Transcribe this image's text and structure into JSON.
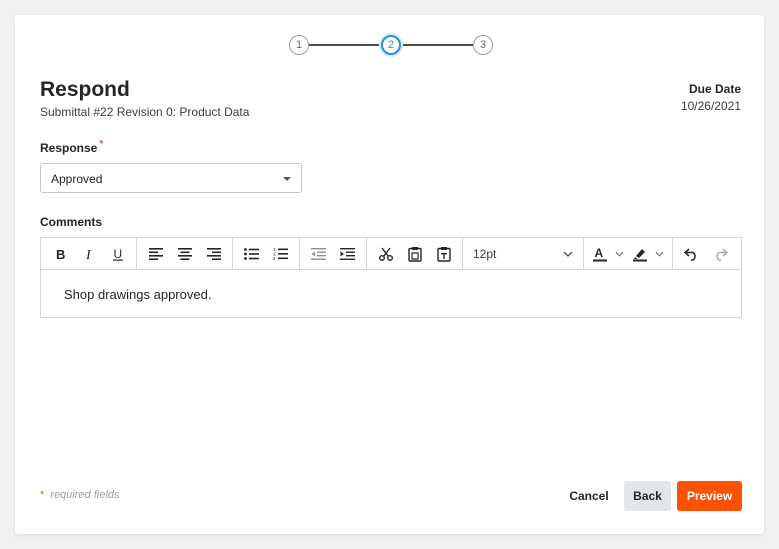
{
  "stepper": {
    "steps": [
      "1",
      "2",
      "3"
    ],
    "active": 2
  },
  "header": {
    "title": "Respond",
    "subtitle": "Submittal #22 Revision 0: Product Data",
    "due_label": "Due Date",
    "due_value": "10/26/2021"
  },
  "response": {
    "label": "Response",
    "required_mark": "*",
    "selected": "Approved"
  },
  "comments": {
    "label": "Comments",
    "font_size": "12pt",
    "body": "Shop drawings approved."
  },
  "toolbar_icons": [
    "bold-icon",
    "italic-icon",
    "underline-icon",
    "align-left-icon",
    "align-center-icon",
    "align-right-icon",
    "bullet-list-icon",
    "numbered-list-icon",
    "outdent-icon",
    "indent-icon",
    "cut-icon",
    "paste-icon",
    "paste-text-icon",
    "text-color-icon",
    "highlight-icon",
    "undo-icon",
    "redo-icon"
  ],
  "footer": {
    "required_star": "*",
    "required_note": "required fields",
    "cancel": "Cancel",
    "back": "Back",
    "preview": "Preview"
  },
  "colors": {
    "accent": "#ff5200",
    "step_active": "#2e8fd6",
    "required": "#f05a28"
  }
}
